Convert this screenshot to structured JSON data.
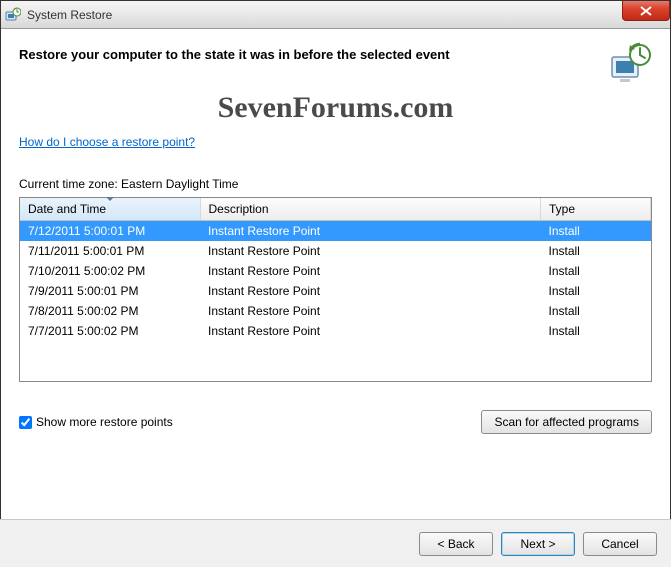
{
  "window": {
    "title": "System Restore"
  },
  "header": {
    "heading": "Restore your computer to the state it was in before the selected event"
  },
  "watermark": "SevenForums.com",
  "help_link": "How do I choose a restore point?",
  "timezone_label": "Current time zone: Eastern Daylight Time",
  "table": {
    "columns": {
      "datetime": "Date and Time",
      "description": "Description",
      "type": "Type"
    },
    "rows": [
      {
        "datetime": "7/12/2011 5:00:01 PM",
        "description": "Instant Restore Point",
        "type": "Install",
        "selected": true
      },
      {
        "datetime": "7/11/2011 5:00:01 PM",
        "description": "Instant Restore Point",
        "type": "Install",
        "selected": false
      },
      {
        "datetime": "7/10/2011 5:00:02 PM",
        "description": "Instant Restore Point",
        "type": "Install",
        "selected": false
      },
      {
        "datetime": "7/9/2011 5:00:01 PM",
        "description": "Instant Restore Point",
        "type": "Install",
        "selected": false
      },
      {
        "datetime": "7/8/2011 5:00:02 PM",
        "description": "Instant Restore Point",
        "type": "Install",
        "selected": false
      },
      {
        "datetime": "7/7/2011 5:00:02 PM",
        "description": "Instant Restore Point",
        "type": "Install",
        "selected": false
      }
    ]
  },
  "show_more": {
    "label": "Show more restore points",
    "checked": true
  },
  "buttons": {
    "scan": "Scan for affected programs",
    "back": "< Back",
    "next": "Next >",
    "cancel": "Cancel"
  }
}
